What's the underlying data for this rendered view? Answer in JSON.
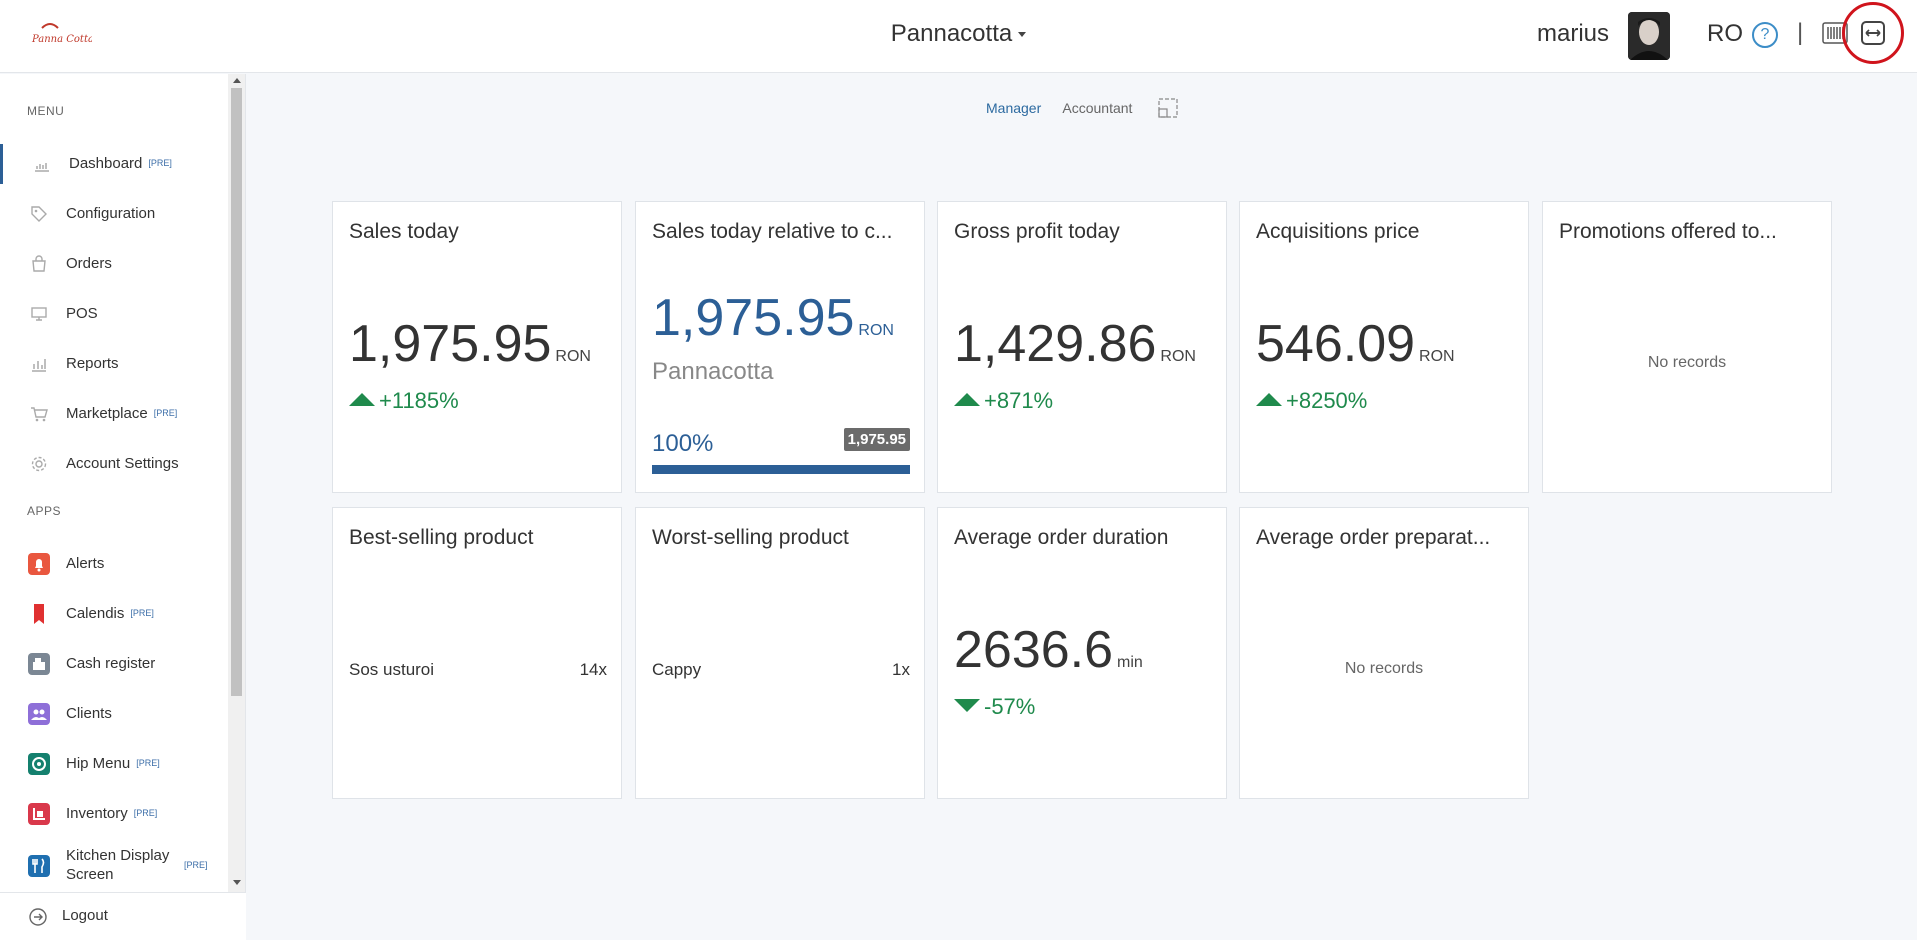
{
  "header": {
    "shop_name": "Pannacotta",
    "user_name": "marius",
    "language": "RO",
    "help_label": "?",
    "separator": "|"
  },
  "sidebar": {
    "menu_title": "MENU",
    "apps_title": "APPS",
    "menu_items": [
      {
        "label": "Dashboard",
        "badge": "[PRE]",
        "icon": "chart-icon"
      },
      {
        "label": "Configuration",
        "icon": "tag-icon"
      },
      {
        "label": "Orders",
        "icon": "bag-icon"
      },
      {
        "label": "POS",
        "icon": "monitor-icon"
      },
      {
        "label": "Reports",
        "icon": "bar-chart-icon"
      },
      {
        "label": "Marketplace",
        "badge": "[PRE]",
        "icon": "cart-icon"
      },
      {
        "label": "Account Settings",
        "icon": "gear-icon"
      }
    ],
    "app_items": [
      {
        "label": "Alerts",
        "icon": "bell-icon",
        "color": "#e9573f"
      },
      {
        "label": "Calendis",
        "badge": "[PRE]",
        "icon": "bookmark-icon",
        "color": "#e03131"
      },
      {
        "label": "Cash register",
        "icon": "register-icon",
        "color": "#7b8794"
      },
      {
        "label": "Clients",
        "icon": "users-icon",
        "color": "#8e6fd8"
      },
      {
        "label": "Hip Menu",
        "badge": "[PRE]",
        "icon": "hipmenu-icon",
        "color": "#14806e"
      },
      {
        "label": "Inventory",
        "badge": "[PRE]",
        "icon": "inventory-icon",
        "color": "#d9384b"
      },
      {
        "label": "Kitchen Display Screen",
        "badge": "[PRE]",
        "icon": "fork-knife-icon",
        "color": "#1f6fb0"
      }
    ],
    "logout_label": "Logout"
  },
  "view_tabs": {
    "manager": "Manager",
    "accountant": "Accountant"
  },
  "cards": {
    "sales_today": {
      "title": "Sales today",
      "value": "1,975.95",
      "unit": "RON",
      "trend": "+1185%"
    },
    "sales_relative": {
      "title": "Sales today relative to c...",
      "value": "1,975.95",
      "unit": "RON",
      "shop": "Pannacotta",
      "percent_label": "100%",
      "badge": "1,975.95",
      "progress": 1.0
    },
    "gross_profit": {
      "title": "Gross profit today",
      "value": "1,429.86",
      "unit": "RON",
      "trend": "+871%"
    },
    "acquisitions": {
      "title": "Acquisitions price",
      "value": "546.09",
      "unit": "RON",
      "trend": "+8250%"
    },
    "promotions": {
      "title": "Promotions offered to...",
      "empty": "No records"
    },
    "best_selling": {
      "title": "Best-selling product",
      "product": "Sos usturoi",
      "count": "14x"
    },
    "worst_selling": {
      "title": "Worst-selling product",
      "product": "Cappy",
      "count": "1x"
    },
    "avg_duration": {
      "title": "Average order duration",
      "value": "2636.6",
      "unit": "min",
      "trend": "-57%"
    },
    "avg_preparation": {
      "title": "Average order preparat...",
      "empty": "No records"
    }
  },
  "colors": {
    "accent": "#2c5f96",
    "positive": "#1f8a4c",
    "highlight": "#d0141c"
  }
}
